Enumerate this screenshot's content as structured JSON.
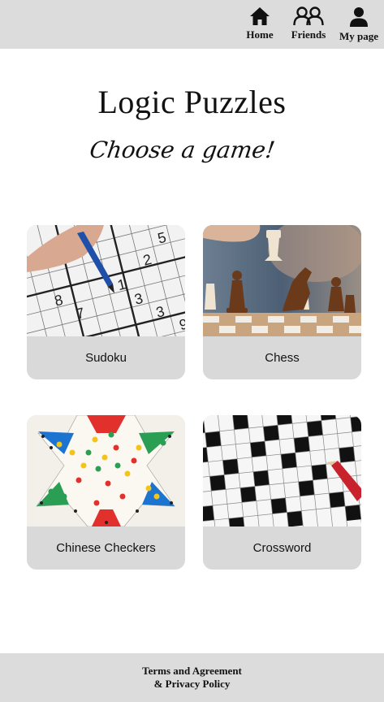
{
  "nav": {
    "home": {
      "label": "Home",
      "icon": "home-icon"
    },
    "friends": {
      "label": "Friends",
      "icon": "friends-icon"
    },
    "my_page": {
      "label": "My page",
      "icon": "user-icon"
    }
  },
  "main": {
    "title": "Logic Puzzles",
    "subtitle": "Choose a game!",
    "games": [
      {
        "label": "Sudoku",
        "image": "sudoku-photo"
      },
      {
        "label": "Chess",
        "image": "chess-photo"
      },
      {
        "label": "Chinese Checkers",
        "image": "chinese-checkers-photo"
      },
      {
        "label": "Crossword",
        "image": "crossword-photo"
      }
    ]
  },
  "footer": {
    "line1": "Terms and Agreement",
    "line2": "& Privacy Policy"
  },
  "colors": {
    "bar_background": "#dcdcdc",
    "card_background": "#d9d9d9",
    "page_background": "#ffffff"
  }
}
